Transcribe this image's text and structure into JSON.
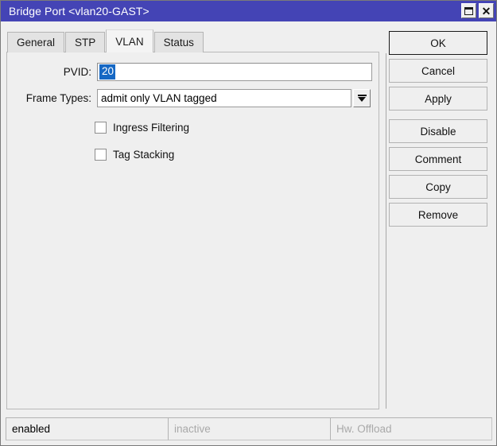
{
  "window": {
    "title": "Bridge Port <vlan20-GAST>",
    "controls": [
      {
        "name": "restore-button",
        "icon": "restore-icon"
      },
      {
        "name": "close-button",
        "icon": "close-icon",
        "glyph": "✕"
      }
    ],
    "colors": {
      "titlebar": "#4444b5",
      "panel": "#efefef",
      "selection": "#1668c4",
      "field": "#ffffff"
    }
  },
  "tabs": [
    {
      "label": "General",
      "active": false
    },
    {
      "label": "STP",
      "active": false
    },
    {
      "label": "VLAN",
      "active": true
    },
    {
      "label": "Status",
      "active": false
    }
  ],
  "form": {
    "pvid": {
      "label": "PVID:",
      "value": "20",
      "selected": true
    },
    "frame_types": {
      "label": "Frame Types:",
      "value": "admit only VLAN tagged",
      "dropdown_icon": "chevron-down-icon"
    },
    "checkboxes": [
      {
        "label": "Ingress Filtering",
        "checked": false
      },
      {
        "label": "Tag Stacking",
        "checked": false
      }
    ]
  },
  "buttons": [
    {
      "label": "OK",
      "default": true
    },
    {
      "label": "Cancel",
      "default": false
    },
    {
      "label": "Apply",
      "default": false
    },
    {
      "label": "Disable",
      "default": false
    },
    {
      "label": "Comment",
      "default": false
    },
    {
      "label": "Copy",
      "default": false
    },
    {
      "label": "Remove",
      "default": false
    }
  ],
  "statusbar": {
    "cells": [
      {
        "text": "enabled",
        "muted": false
      },
      {
        "text": "inactive",
        "muted": true
      },
      {
        "text": "Hw. Offload",
        "muted": true
      }
    ]
  }
}
